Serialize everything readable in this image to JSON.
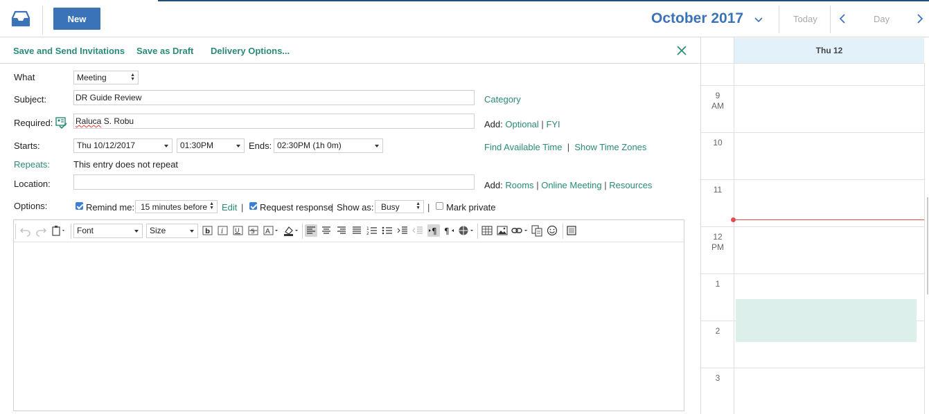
{
  "header": {
    "new_label": "New",
    "month_title": "October 2017",
    "today_label": "Today",
    "view_label": "Day"
  },
  "actions": {
    "save_send": "Save and Send Invitations",
    "save_draft": "Save as Draft",
    "delivery": "Delivery Options..."
  },
  "form": {
    "what_label": "What",
    "what_value": "Meeting",
    "subject_label": "Subject:",
    "subject_value": "DR Guide Review",
    "category_link": "Category",
    "required_label": "Required:",
    "required_first": "Raluca",
    "required_rest": " S. Robu",
    "add_label": "Add:",
    "optional_link": "Optional",
    "fyi_link": "FYI",
    "starts_label": "Starts:",
    "start_date": "Thu 10/12/2017",
    "start_time": "01:30PM",
    "ends_label": "Ends:",
    "end_time": "02:30PM (1h 0m)",
    "find_time_link": "Find Available Time",
    "time_zones_link": "Show Time Zones",
    "repeats_label": "Repeats:",
    "repeats_value": "This entry does not repeat",
    "location_label": "Location:",
    "location_value": "",
    "rooms_link": "Rooms",
    "online_meeting_link": "Online Meeting",
    "resources_link": "Resources",
    "options_label": "Options:",
    "remind_label": "Remind me:",
    "remind_checked": true,
    "remind_value": "15 minutes before",
    "edit_link": "Edit",
    "request_label": "Request response",
    "request_checked": true,
    "show_as_label": "Show as:",
    "show_as_value": "Busy",
    "private_label": "Mark private",
    "private_checked": false,
    "separator": "|"
  },
  "editor": {
    "font_value": "Font",
    "size_value": "Size"
  },
  "calendar": {
    "day_header": "Thu 12",
    "hours": [
      {
        "num": "9",
        "ampm": "AM"
      },
      {
        "num": "10",
        "ampm": ""
      },
      {
        "num": "11",
        "ampm": ""
      },
      {
        "num": "12",
        "ampm": "PM"
      },
      {
        "num": "1",
        "ampm": ""
      },
      {
        "num": "2",
        "ampm": ""
      },
      {
        "num": "3",
        "ampm": ""
      }
    ]
  },
  "colors": {
    "accent_blue": "#3b73b9",
    "teal_link": "#2a8a78",
    "event_fill": "#dcefea",
    "now_line": "#e05050"
  }
}
